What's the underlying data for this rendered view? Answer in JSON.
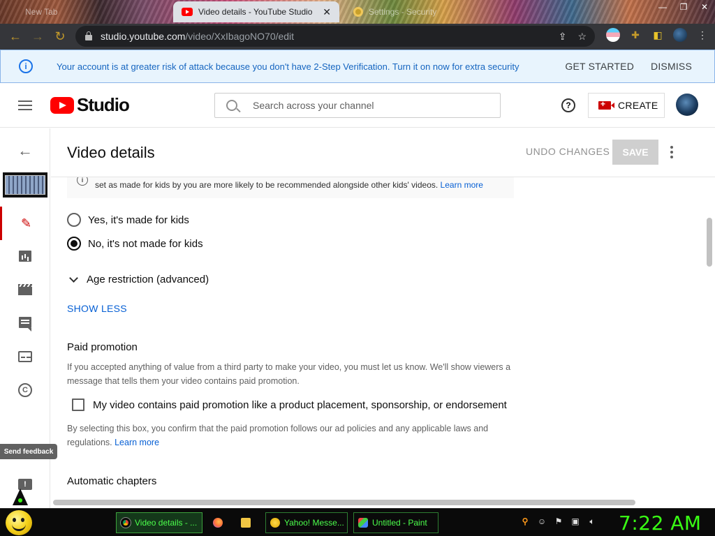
{
  "browser": {
    "tabs": [
      {
        "label": "New Tab",
        "active": false
      },
      {
        "label": "Video details - YouTube Studio",
        "active": true
      },
      {
        "label": "Settings - Security",
        "active": false
      }
    ],
    "url_host": "studio.youtube.com",
    "url_path": "/video/XxIbagoNO70/edit"
  },
  "banner": {
    "message": "Your account is at greater risk of attack because you don't have 2-Step Verification. Turn it on now for extra security",
    "get_started": "GET STARTED",
    "dismiss": "DISMISS"
  },
  "header": {
    "logo_text": "Studio",
    "search_placeholder": "Search across your channel",
    "create_label": "CREATE",
    "help_glyph": "?"
  },
  "toolbar": {
    "title": "Video details",
    "undo_label": "UNDO CHANGES",
    "save_label": "SAVE"
  },
  "made_for_kids": {
    "info_text": "set as made for kids by you are more likely to be recommended alongside other kids' videos.",
    "learn_more": "Learn more",
    "options": [
      {
        "label": "Yes, it's made for kids",
        "checked": false
      },
      {
        "label": "No, it's not made for kids",
        "checked": true
      }
    ]
  },
  "age_restriction": {
    "label": "Age restriction (advanced)"
  },
  "show_less_label": "SHOW LESS",
  "paid_promotion": {
    "title": "Paid promotion",
    "description": "If you accepted anything of value from a third party to make your video, you must let us know. We'll show viewers a message that tells them your video contains paid promotion.",
    "checkbox_label": "My video contains paid promotion like a product placement, sponsorship, or endorsement",
    "checked": false,
    "note": "By selecting this box, you confirm that the paid promotion follows our ad policies and any applicable laws and regulations.",
    "learn_more": "Learn more"
  },
  "automatic_chapters": {
    "title": "Automatic chapters"
  },
  "sidebar": {
    "feedback_label": "Send feedback",
    "items": [
      {
        "icon": "back-arrow-icon"
      },
      {
        "icon": "video-thumbnail"
      },
      {
        "icon": "pencil-icon",
        "active": true
      },
      {
        "icon": "analytics-icon"
      },
      {
        "icon": "editor-clapper-icon"
      },
      {
        "icon": "comments-icon"
      },
      {
        "icon": "subtitles-icon"
      },
      {
        "icon": "copyright-icon"
      }
    ]
  },
  "taskbar": {
    "buttons": [
      {
        "label": "Video details - ...",
        "icon": "chrome-icon",
        "active": true
      },
      {
        "label": "",
        "icon": "firefox-icon"
      },
      {
        "label": "",
        "icon": "folder-icon"
      },
      {
        "label": "Yahoo! Messe...",
        "icon": "yahoo-messenger-icon"
      },
      {
        "label": "Untitled - Paint",
        "icon": "paint-icon"
      }
    ],
    "clock": "7:22 AM"
  },
  "colors": {
    "accent_red": "#cc0000",
    "link_blue": "#065fd4",
    "banner_bg": "#e8f4fd",
    "taskbar_text": "#39ff14"
  }
}
